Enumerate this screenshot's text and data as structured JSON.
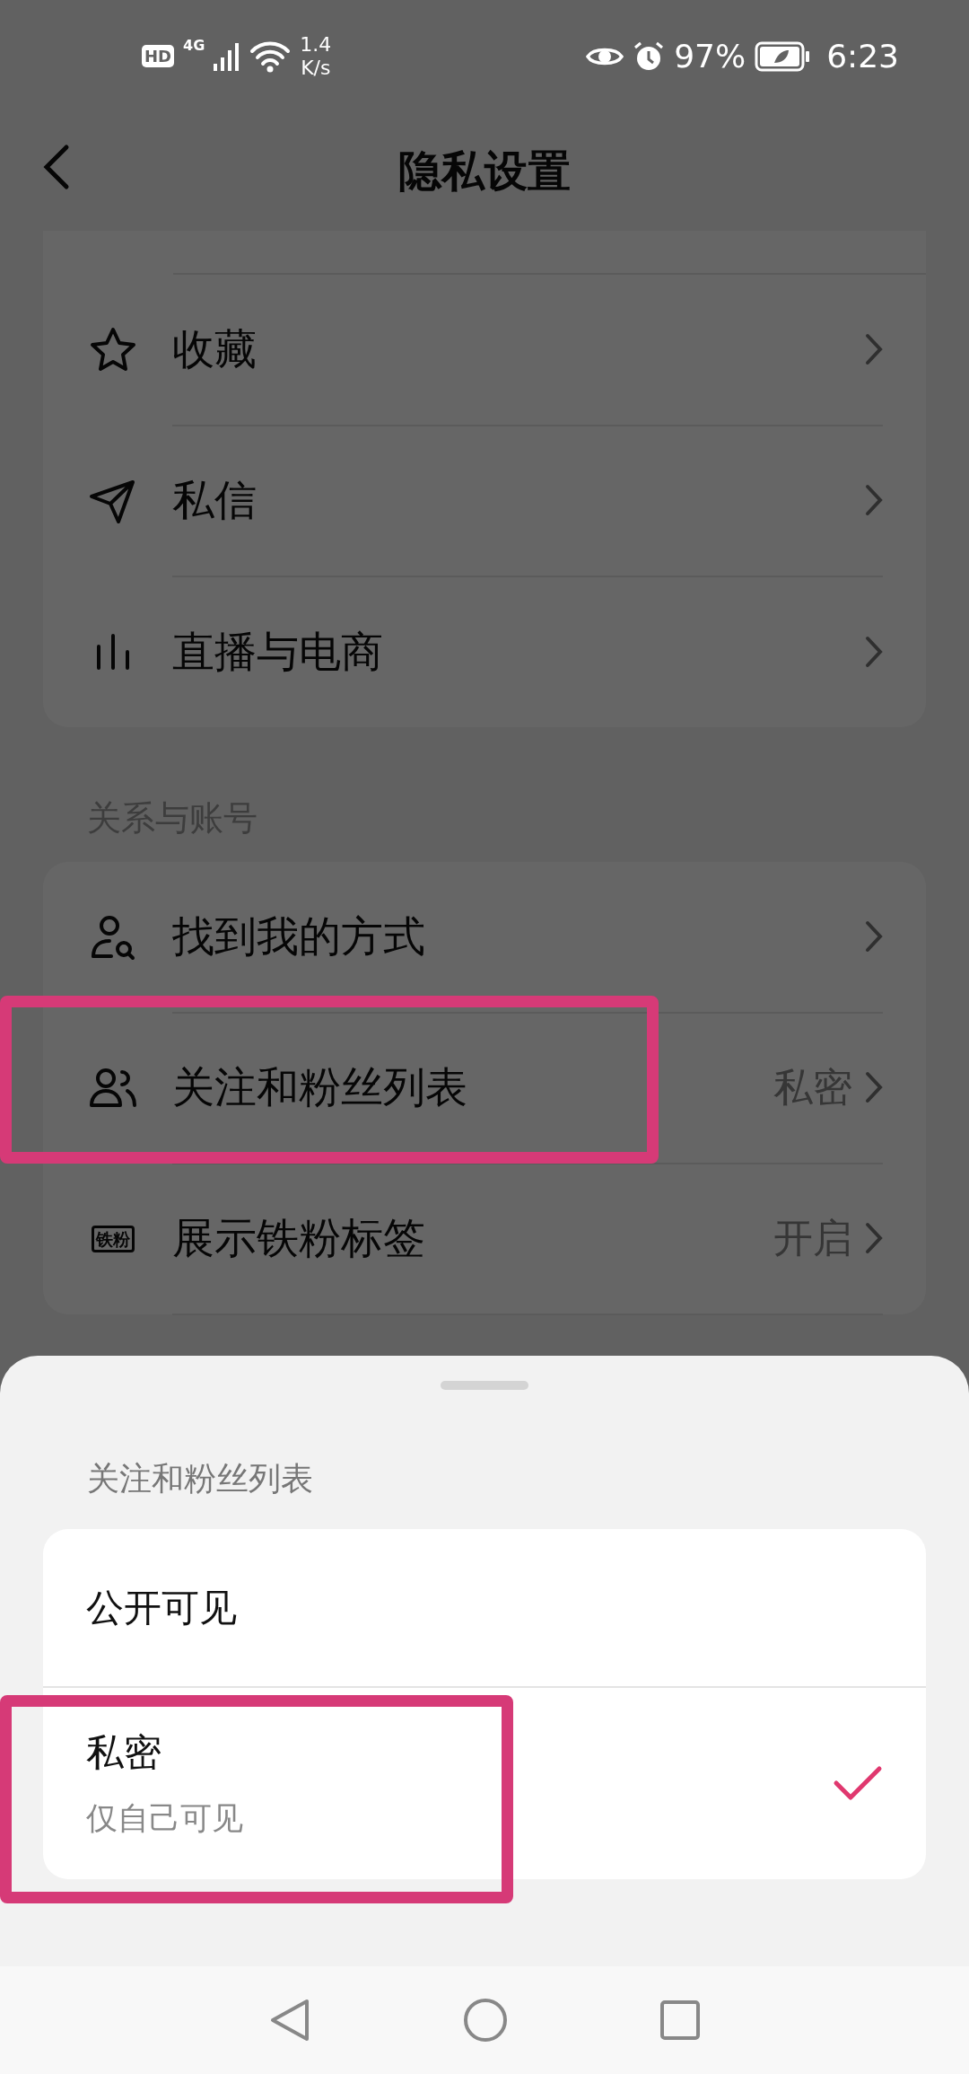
{
  "status_bar": {
    "hd_label": "HD",
    "network_label": "4G",
    "speed": "1.4",
    "speed_unit": "K/s",
    "battery": "97%",
    "time": "6:23"
  },
  "header": {
    "title": "隐私设置"
  },
  "sections": [
    {
      "items": [
        {
          "label": "收藏",
          "highlighted": false
        },
        {
          "label": "私信",
          "highlighted": false
        },
        {
          "label": "直播与电商",
          "highlighted": false
        }
      ]
    },
    {
      "title": "关系与账号",
      "items": [
        {
          "label": "找到我的方式",
          "highlighted": false
        },
        {
          "label": "关注和粉丝列表",
          "value": "私密",
          "highlighted": true
        },
        {
          "label": "展示铁粉标签",
          "value": "开启",
          "badge": "铁粉",
          "highlighted": false
        }
      ]
    }
  ],
  "sheet": {
    "title": "关注和粉丝列表",
    "options": [
      {
        "label": "公开可见",
        "selected": false,
        "highlighted": false
      },
      {
        "label": "私密",
        "description": "仅自己可见",
        "selected": true,
        "highlighted": true
      }
    ]
  }
}
